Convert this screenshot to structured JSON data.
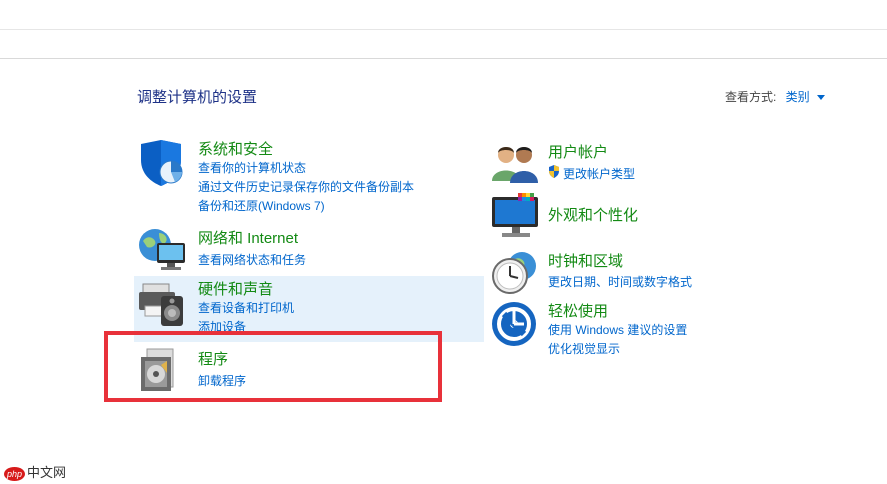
{
  "header": {
    "title": "调整计算机的设置"
  },
  "view_by": {
    "label": "查看方式:",
    "value": "类别"
  },
  "categories_left": [
    {
      "title": "系统和安全",
      "icon": "shield-icon",
      "links": [
        "查看你的计算机状态",
        "通过文件历史记录保存你的文件备份副本",
        "备份和还原(Windows 7)"
      ]
    },
    {
      "title": "网络和 Internet",
      "icon": "network-globe-icon",
      "links": [
        "查看网络状态和任务"
      ]
    },
    {
      "title": "硬件和声音",
      "icon": "printer-speaker-icon",
      "links": [
        "查看设备和打印机",
        "添加设备"
      ]
    },
    {
      "title": "程序",
      "icon": "programs-disc-icon",
      "links": [
        "卸载程序"
      ]
    }
  ],
  "categories_right": [
    {
      "title": "用户帐户",
      "icon": "users-icon",
      "links": [
        "更改帐户类型"
      ]
    },
    {
      "title": "外观和个性化",
      "icon": "monitor-palette-icon",
      "links": []
    },
    {
      "title": "时钟和区域",
      "icon": "clock-globe-icon",
      "links": [
        "更改日期、时间或数字格式"
      ]
    },
    {
      "title": "轻松使用",
      "icon": "ease-of-access-icon",
      "links": [
        "使用 Windows 建议的设置",
        "优化视觉显示"
      ]
    }
  ],
  "watermark": {
    "badge": "php",
    "text": "中文网"
  },
  "colors": {
    "title_green": "#138a14",
    "link_blue": "#0066cc",
    "highlight": "#e5f1fb",
    "red_box": "#e8313a"
  }
}
